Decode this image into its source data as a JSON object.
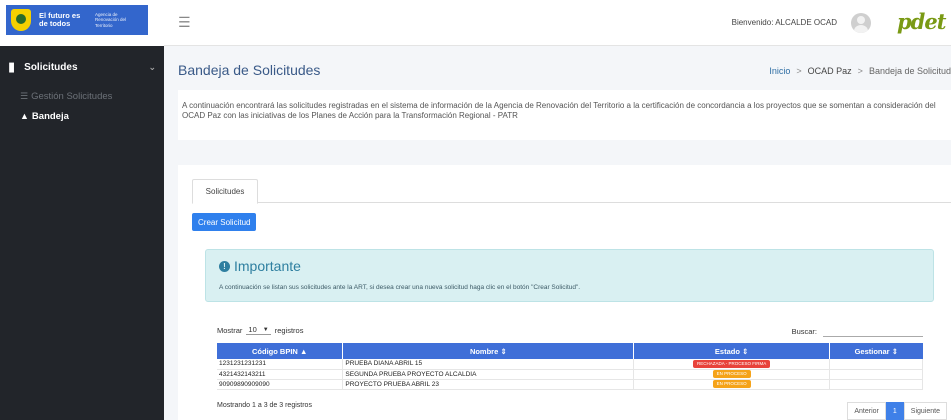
{
  "brand": {
    "line1": "El futuro es de todos",
    "line2": "Agencia de Renovación del Territorio"
  },
  "sidebar": {
    "section": "Solicitudes",
    "items": [
      {
        "label": "Gestión Solicitudes"
      },
      {
        "label": "Bandeja"
      }
    ]
  },
  "topbar": {
    "welcome": "Bienvenido: ALCALDE OCAD",
    "logo": "pdet"
  },
  "header": {
    "title": "Bandeja de Solicitudes",
    "breadcrumb": [
      "Inicio",
      "OCAD Paz",
      "Bandeja de Solicitud"
    ]
  },
  "description": "A continuación encontrará las solicitudes registradas en el sistema de información de la Agencia de Renovación del Territorio a la certificación de concordancia a los proyectos que se somentan a consideración del OCAD Paz con las iniciativas de los Planes de Acción para la Transformación Regional - PATR",
  "tabs": [
    {
      "label": "Solicitudes"
    }
  ],
  "create_button": "Crear Solicitud",
  "alert": {
    "title": "Importante",
    "text": "A continuación se listan sus solicitudes ante la ART, si desea crear una nueva solicitud haga clic en el botón \"Crear Solicitud\"."
  },
  "table_controls": {
    "show_label": "Mostrar",
    "page_size": "10",
    "records_label": "registros",
    "search_label": "Buscar:",
    "search_value": ""
  },
  "table": {
    "columns": [
      "Código BPIN",
      "Nombre",
      "Estado",
      "Gestionar"
    ],
    "sort_icons": [
      "▲",
      "⇕",
      "⇕",
      "⇕"
    ],
    "rows": [
      {
        "bpin": "1231231231231",
        "name": "PRUEBA DIANA ABRIL 15",
        "status": "RECHAZADA - PROCESO FIRMA",
        "status_color": "#e8433b"
      },
      {
        "bpin": "4321432143211",
        "name": "SEGUNDA PRUEBA PROYECTO ALCALDIA",
        "status": "EN PROCESO",
        "status_color": "#f5a31a"
      },
      {
        "bpin": "90909890909090",
        "name": "PROYECTO PRUEBA ABRIL 23",
        "status": "EN PROCESO",
        "status_color": "#f5a31a"
      }
    ]
  },
  "footer": {
    "info": "Mostrando 1 a 3 de 3 registros",
    "prev": "Anterior",
    "page": "1",
    "next": "Siguiente"
  }
}
